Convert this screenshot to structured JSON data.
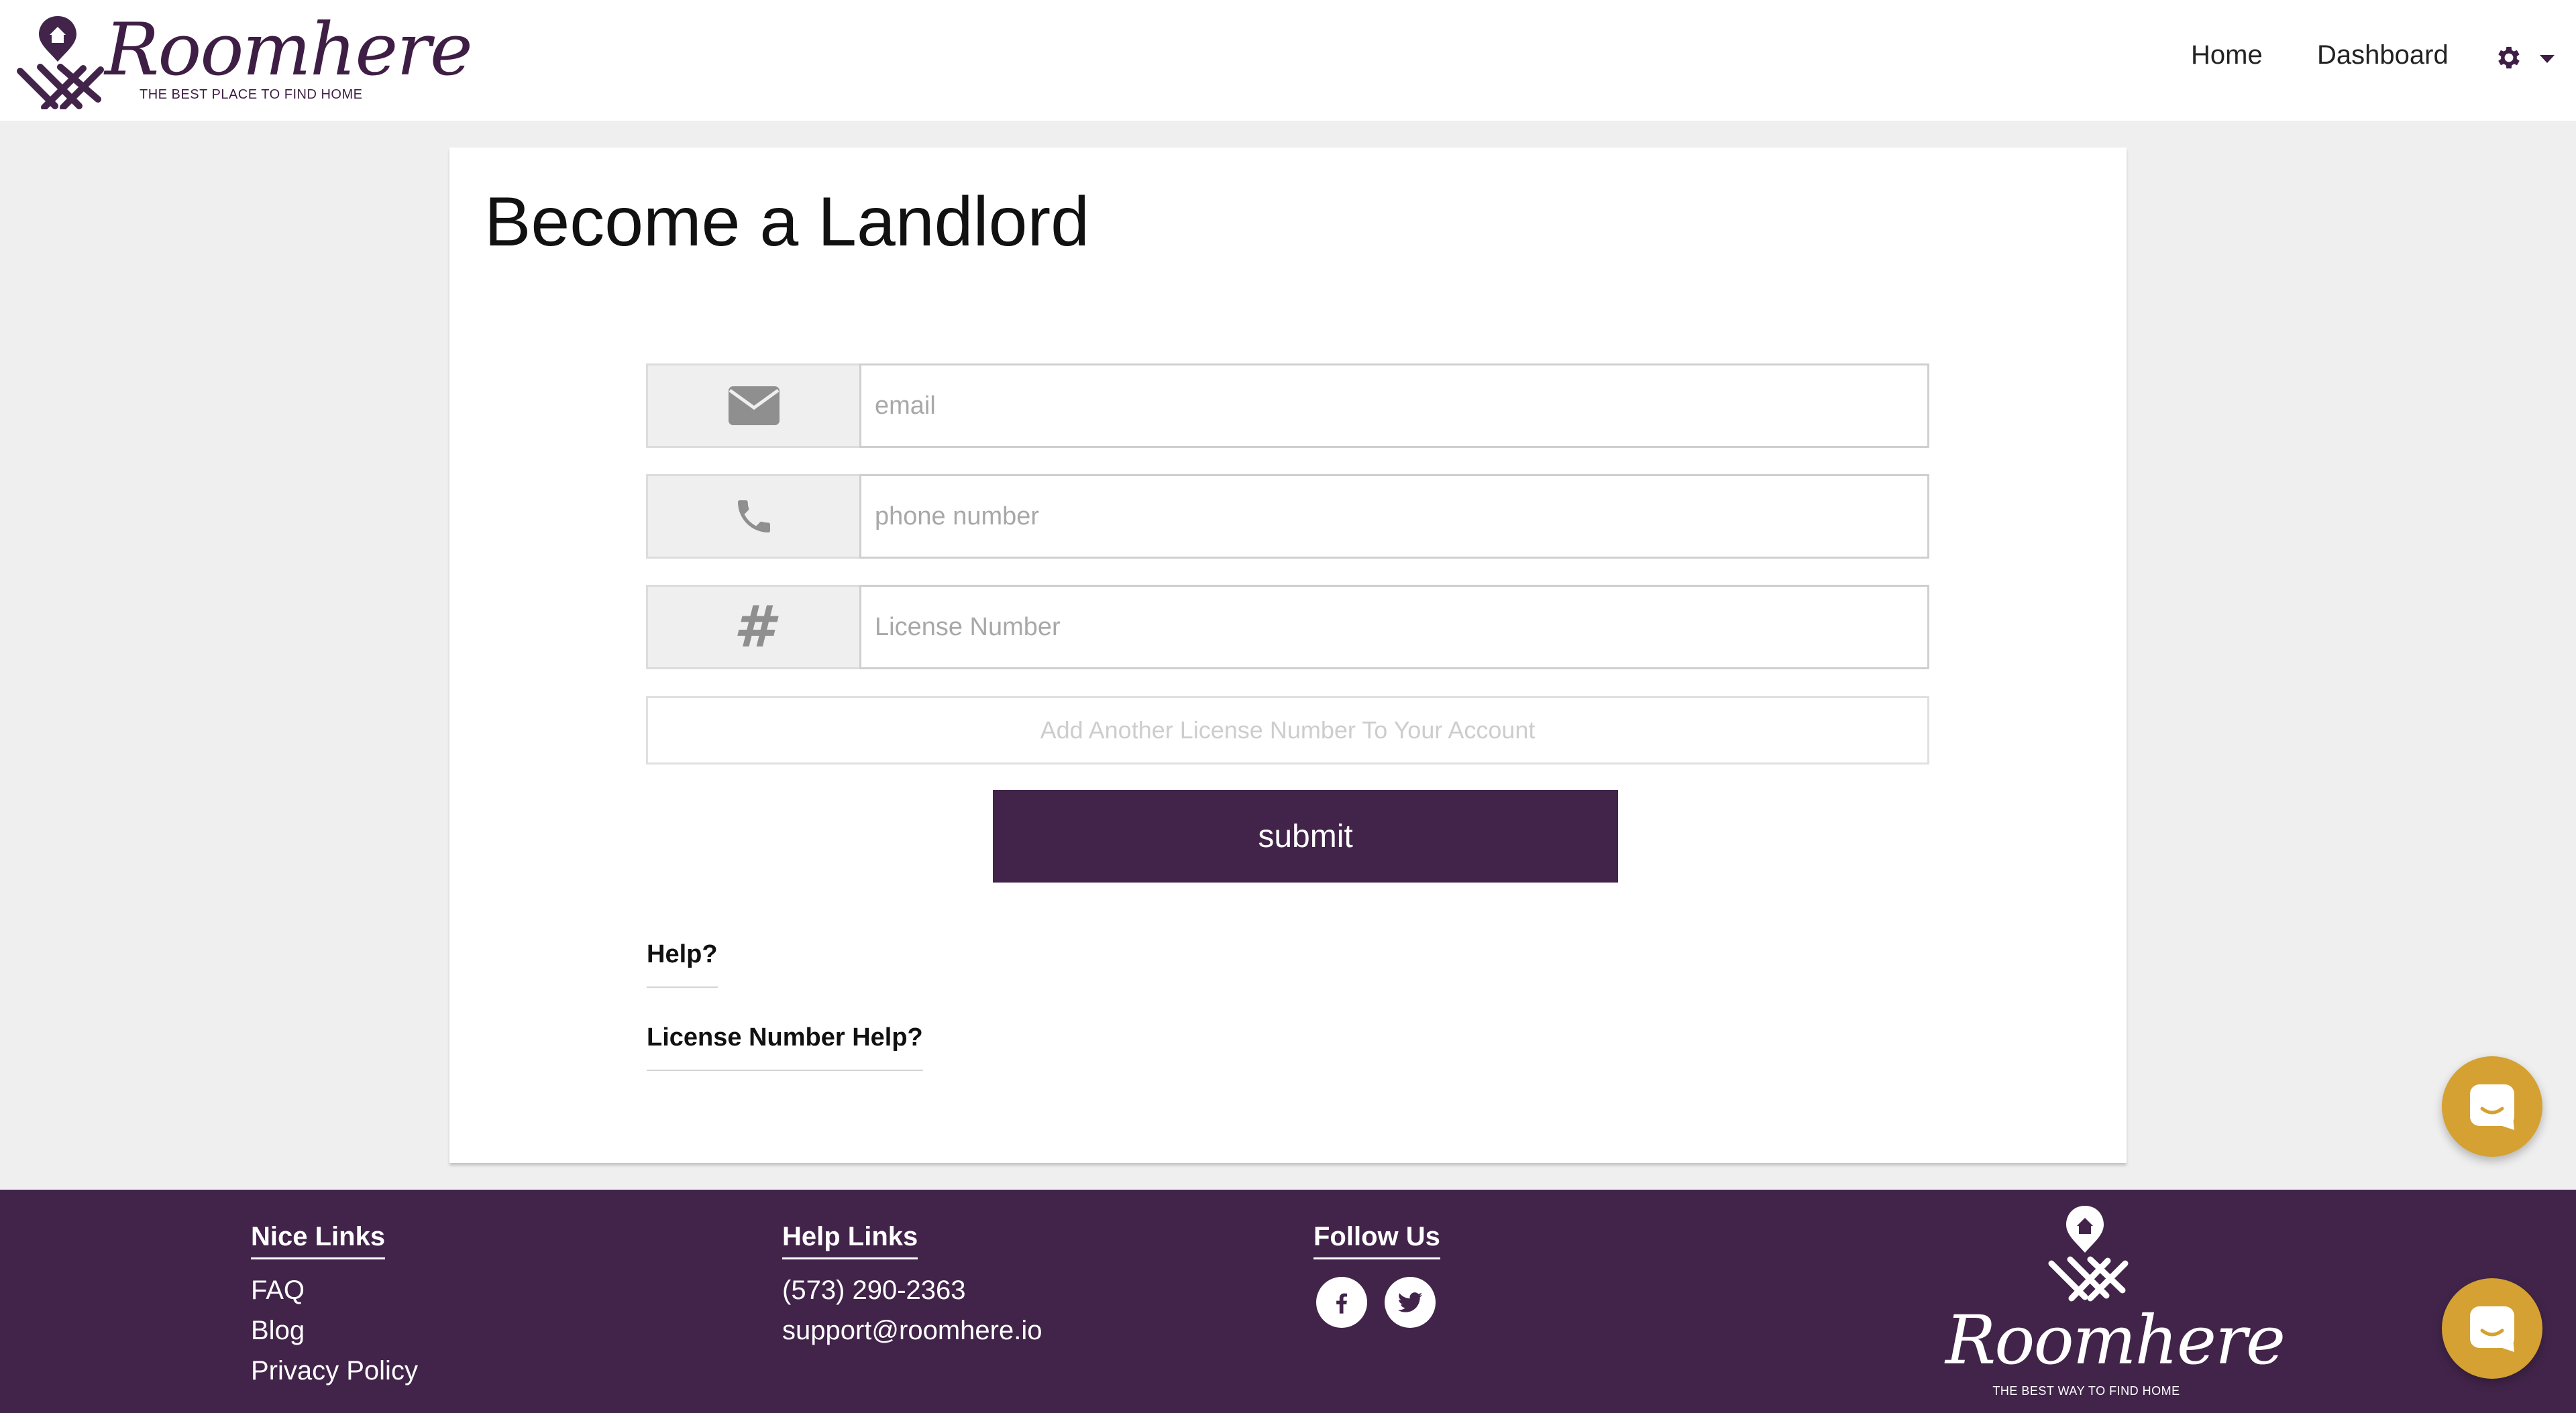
{
  "header": {
    "logo_text": "Roomhere",
    "logo_tagline": "THE BEST PLACE TO FIND HOME",
    "nav": {
      "home": "Home",
      "dashboard": "Dashboard"
    },
    "settings_icon": "gear-icon"
  },
  "main": {
    "title": "Become a Landlord",
    "fields": {
      "email": {
        "placeholder": "email",
        "value": "",
        "icon": "envelope-icon"
      },
      "phone": {
        "placeholder": "phone number",
        "value": "",
        "icon": "phone-icon"
      },
      "license": {
        "placeholder": "License Number",
        "value": "",
        "icon": "hash-icon",
        "icon_glyph": "#"
      }
    },
    "add_license_label": "Add Another License Number To Your Account",
    "submit_label": "submit",
    "help_links": [
      "Help?",
      "License Number Help?"
    ]
  },
  "footer": {
    "nice_links": {
      "heading": "Nice Links",
      "items": [
        "FAQ",
        "Blog",
        "Privacy Policy"
      ]
    },
    "help_links": {
      "heading": "Help Links",
      "phone": "(573) 290-2363",
      "email": "support@roomhere.io"
    },
    "follow_us": {
      "heading": "Follow Us",
      "networks": [
        "facebook",
        "twitter"
      ]
    },
    "logo_text": "Roomhere",
    "logo_tagline": "THE BEST WAY TO FIND HOME"
  },
  "colors": {
    "brand": "#42244a",
    "chat_accent": "#d4a132",
    "background": "#efefef"
  }
}
